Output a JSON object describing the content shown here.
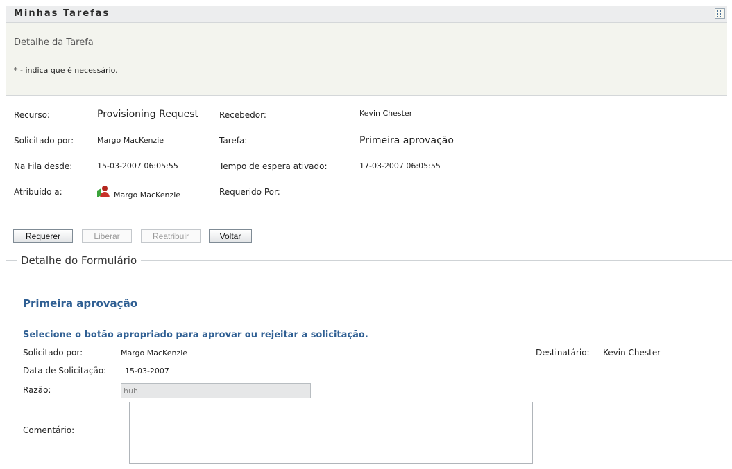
{
  "window": {
    "title": "Minhas Tarefas"
  },
  "panel": {
    "title": "Detalhe da Tarefa",
    "required_note": "* - indica que é necessário."
  },
  "task": {
    "resource_label": "Recurso:",
    "resource_value": "Provisioning Request",
    "recipient_label": "Recebedor:",
    "recipient_value": "Kevin Chester",
    "requested_by_label": "Solicitado por:",
    "requested_by_value": "Margo MacKenzie",
    "task_label": "Tarefa:",
    "task_value": "Primeira aprovação",
    "queued_label": "Na Fila desde:",
    "queued_value": "15-03-2007 06:05:55",
    "wait_label": "Tempo de espera ativado:",
    "wait_value": "17-03-2007 06:05:55",
    "assigned_label": "Atribuído a:",
    "assigned_value": "Margo MacKenzie",
    "claimed_label": "Requerido Por:"
  },
  "buttons": {
    "claim": "Requerer",
    "release": "Liberar",
    "reassign": "Reatribuir",
    "back": "Voltar"
  },
  "form": {
    "legend": "Detalhe do Formulário",
    "heading": "Primeira aprovação",
    "instruction": "Selecione o botão apropriado para aprovar ou rejeitar a solicitação.",
    "requested_by_label": "Solicitado por:",
    "requested_by_value": "Margo MacKenzie",
    "recipient_label": "Destinatário:",
    "recipient_value": "Kevin Chester",
    "request_date_label": "Data de Solicitação:",
    "request_date_value": "15-03-2007",
    "reason_label": "Razão:",
    "reason_value": "huh",
    "comment_label": "Comentário:"
  }
}
